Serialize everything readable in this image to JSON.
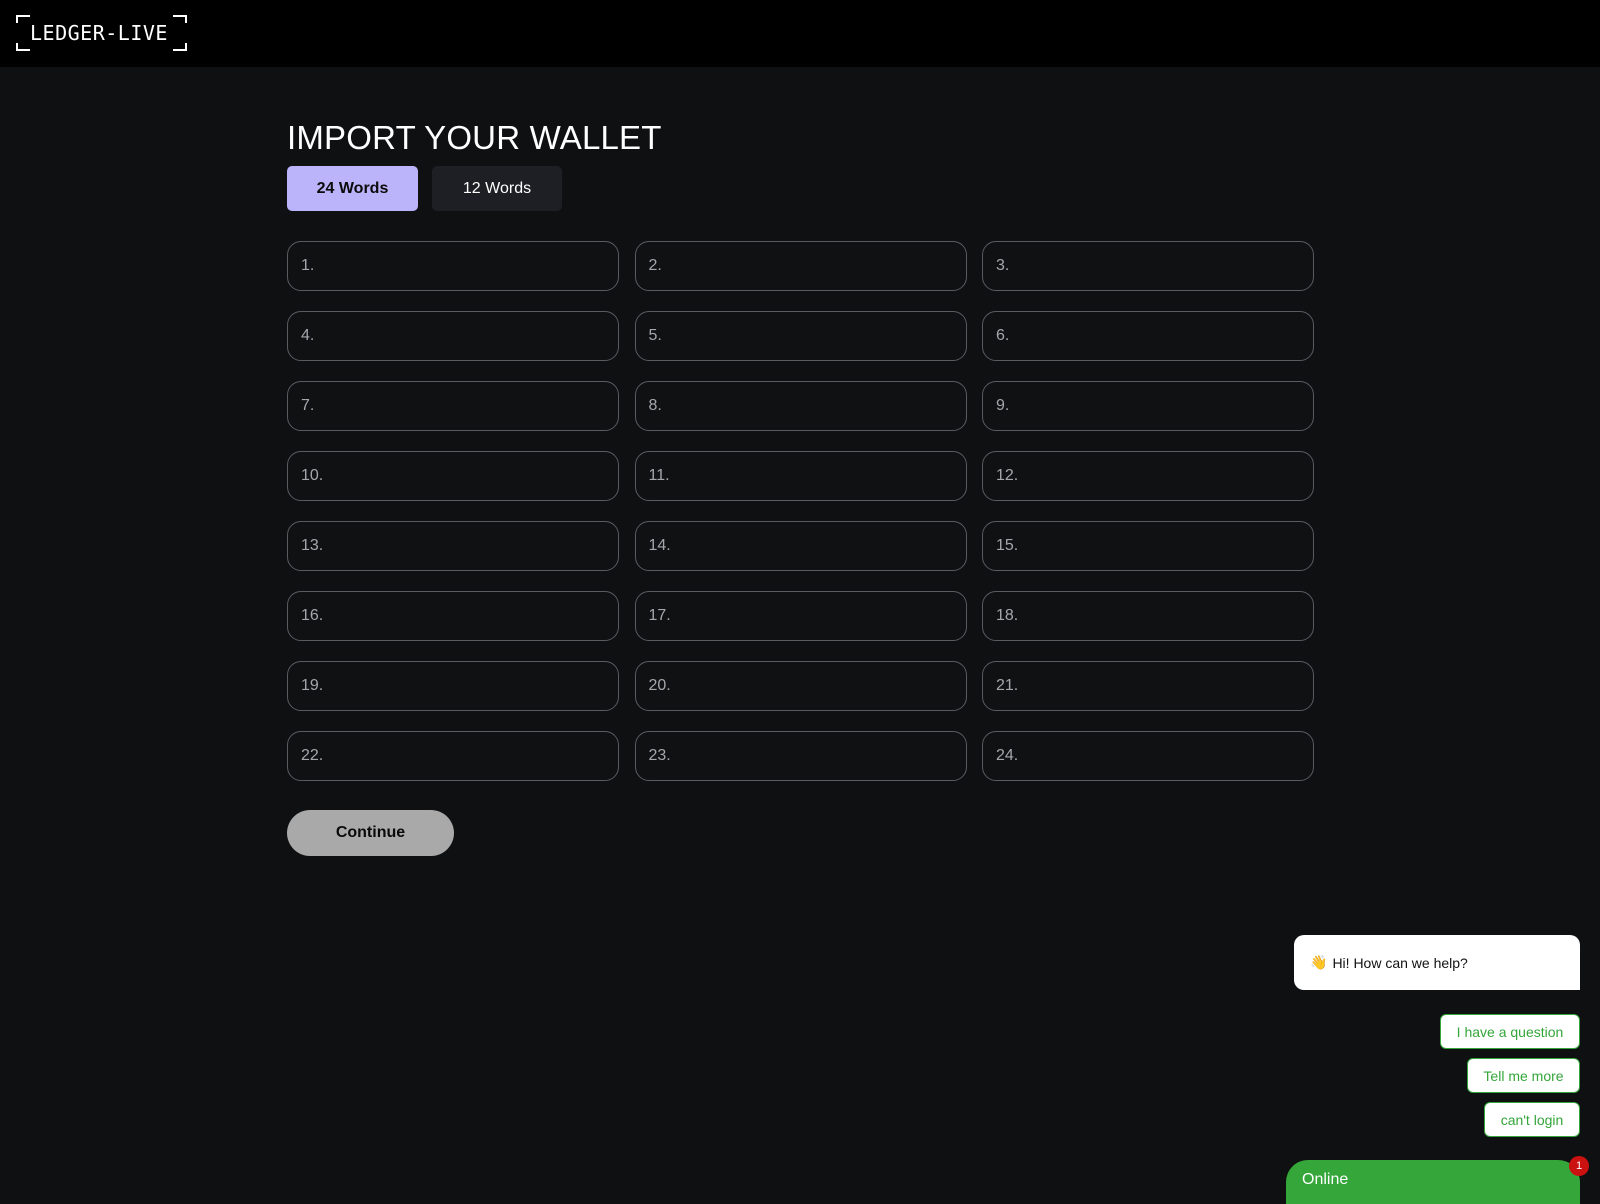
{
  "header": {
    "logo_text": "LEDGER-LIVE"
  },
  "main": {
    "title": "IMPORT YOUR WALLET",
    "tabs": [
      {
        "label": "24 Words",
        "active": true
      },
      {
        "label": "12 Words",
        "active": false
      }
    ],
    "word_fields": [
      {
        "label": "1.",
        "value": ""
      },
      {
        "label": "2.",
        "value": ""
      },
      {
        "label": "3.",
        "value": ""
      },
      {
        "label": "4.",
        "value": ""
      },
      {
        "label": "5.",
        "value": ""
      },
      {
        "label": "6.",
        "value": ""
      },
      {
        "label": "7.",
        "value": ""
      },
      {
        "label": "8.",
        "value": ""
      },
      {
        "label": "9.",
        "value": ""
      },
      {
        "label": "10.",
        "value": ""
      },
      {
        "label": "11.",
        "value": ""
      },
      {
        "label": "12.",
        "value": ""
      },
      {
        "label": "13.",
        "value": ""
      },
      {
        "label": "14.",
        "value": ""
      },
      {
        "label": "15.",
        "value": ""
      },
      {
        "label": "16.",
        "value": ""
      },
      {
        "label": "17.",
        "value": ""
      },
      {
        "label": "18.",
        "value": ""
      },
      {
        "label": "19.",
        "value": ""
      },
      {
        "label": "20.",
        "value": ""
      },
      {
        "label": "21.",
        "value": ""
      },
      {
        "label": "22.",
        "value": ""
      },
      {
        "label": "23.",
        "value": ""
      },
      {
        "label": "24.",
        "value": ""
      }
    ],
    "continue_label": "Continue"
  },
  "chat": {
    "greeting_icon": "👋",
    "greeting": "Hi! How can we help?",
    "quick_replies": [
      "I have a question",
      "Tell me more",
      "can't login"
    ],
    "status": "Online",
    "badge_count": "1"
  },
  "colors": {
    "background": "#0f1012",
    "topbar": "#000000",
    "tab_active": "#bbb4fb",
    "tab_inactive": "#1d1f24",
    "continue_button": "#a9a9a9",
    "chat_green": "#34a63a",
    "badge_red": "#cc1111"
  }
}
